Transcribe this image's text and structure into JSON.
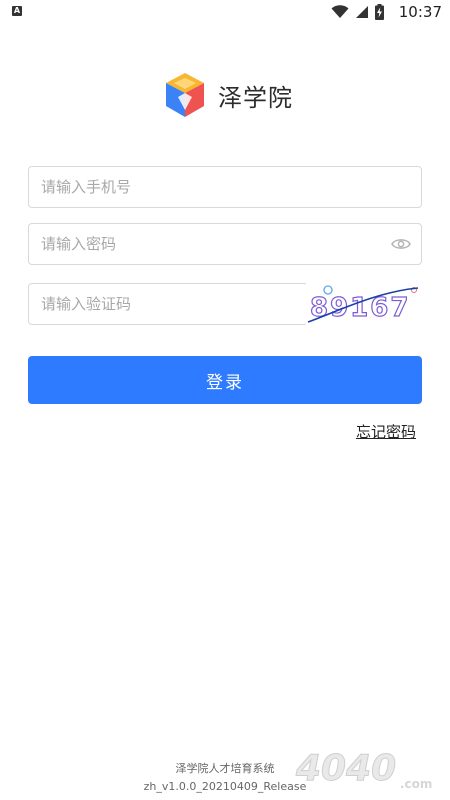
{
  "status_bar": {
    "time": "10:37",
    "left_icon": "android-notification-icon",
    "icons": [
      "wifi-icon",
      "cellular-signal-icon",
      "battery-charging-icon"
    ]
  },
  "brand": {
    "name": "泽学院",
    "logo_icon": "zexueyuan-cube-logo",
    "colors": {
      "yellow": "#f7b733",
      "blue": "#3b82f6",
      "red": "#ef5350"
    }
  },
  "form": {
    "phone_placeholder": "请输入手机号",
    "phone_value": "",
    "password_placeholder": "请输入密码",
    "password_value": "",
    "password_toggle_icon": "eye-icon",
    "captcha_placeholder": "请输入验证码",
    "captcha_value": "",
    "captcha_text": "89167",
    "login_label": "登录",
    "forgot_label": "忘记密码"
  },
  "footer": {
    "title": "泽学院人才培育系统",
    "version": "zh_v1.0.0_20210409_Release"
  },
  "watermark": {
    "text": "4040",
    "suffix": ".com"
  },
  "colors": {
    "primary": "#2f7bff",
    "border": "#d9d9d9",
    "placeholder": "#a8a8a8"
  }
}
